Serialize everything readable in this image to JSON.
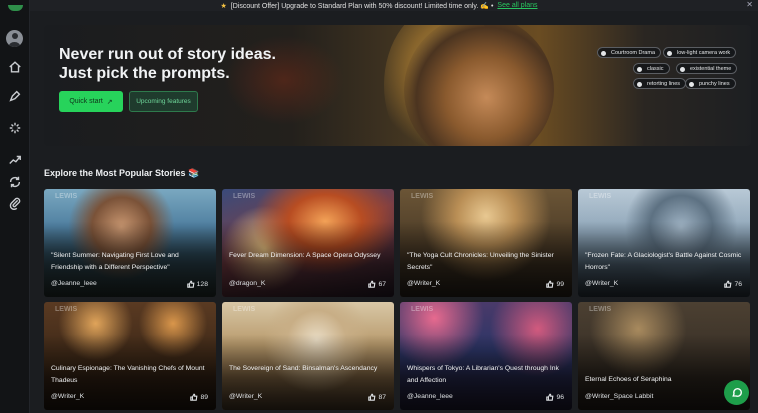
{
  "promo": {
    "star": "★",
    "text": "[Discount Offer] Upgrade to Standard Plan with 50% discount! Limited time only. ✍️ •",
    "link": "See all plans",
    "close": "✕"
  },
  "sidebar": {
    "icons": [
      "home-icon",
      "pen-icon",
      "sparkle-icon",
      "trending-icon",
      "cycle-icon",
      "paperclip-icon"
    ]
  },
  "hero": {
    "headline_line1": "Never run out of story ideas.",
    "headline_line2": "Just pick the prompts.",
    "quick_start": "Quick start",
    "quick_start_arrow": "↗",
    "upcoming": "Upcoming features",
    "tags": [
      "Courtroom Drama",
      "low-light camera work",
      "classic",
      "existential theme",
      "retorting lines",
      "punchy lines"
    ]
  },
  "section_title": "Explore the Most Popular Stories 📚",
  "watermark": "LEWIS",
  "cards": [
    {
      "title": "\"Silent Summer: Navigating First Love and Friendship with a Different Perspective\"",
      "author": "@Jeanne_leee",
      "likes": "128"
    },
    {
      "title": "Fever Dream Dimension: A Space Opera Odyssey",
      "author": "@dragon_K",
      "likes": "67"
    },
    {
      "title": "\"The Yoga Cult Chronicles: Unveiling the Sinister Secrets\"",
      "author": "@Writer_K",
      "likes": "99"
    },
    {
      "title": "\"Frozen Fate: A Glaciologist's Battle Against Cosmic Horrors\"",
      "author": "@Writer_K",
      "likes": "76"
    },
    {
      "title": "Culinary Espionage: The Vanishing Chefs of Mount Thadeus",
      "author": "@Writer_K",
      "likes": "89"
    },
    {
      "title": "The Sovereign of Sand: Binsalman's Ascendancy",
      "author": "@Writer_K",
      "likes": "87"
    },
    {
      "title": "Whispers of Tokyo: A Librarian's Quest through Ink and Affection",
      "author": "@Jeanne_leee",
      "likes": "96"
    },
    {
      "title": "Eternal Echoes of Seraphina",
      "author": "@Writer_Space Labbit",
      "likes": ""
    }
  ],
  "colors": {
    "accent": "#27d35b",
    "background": "#1b1d20",
    "sidebar": "#121416"
  }
}
